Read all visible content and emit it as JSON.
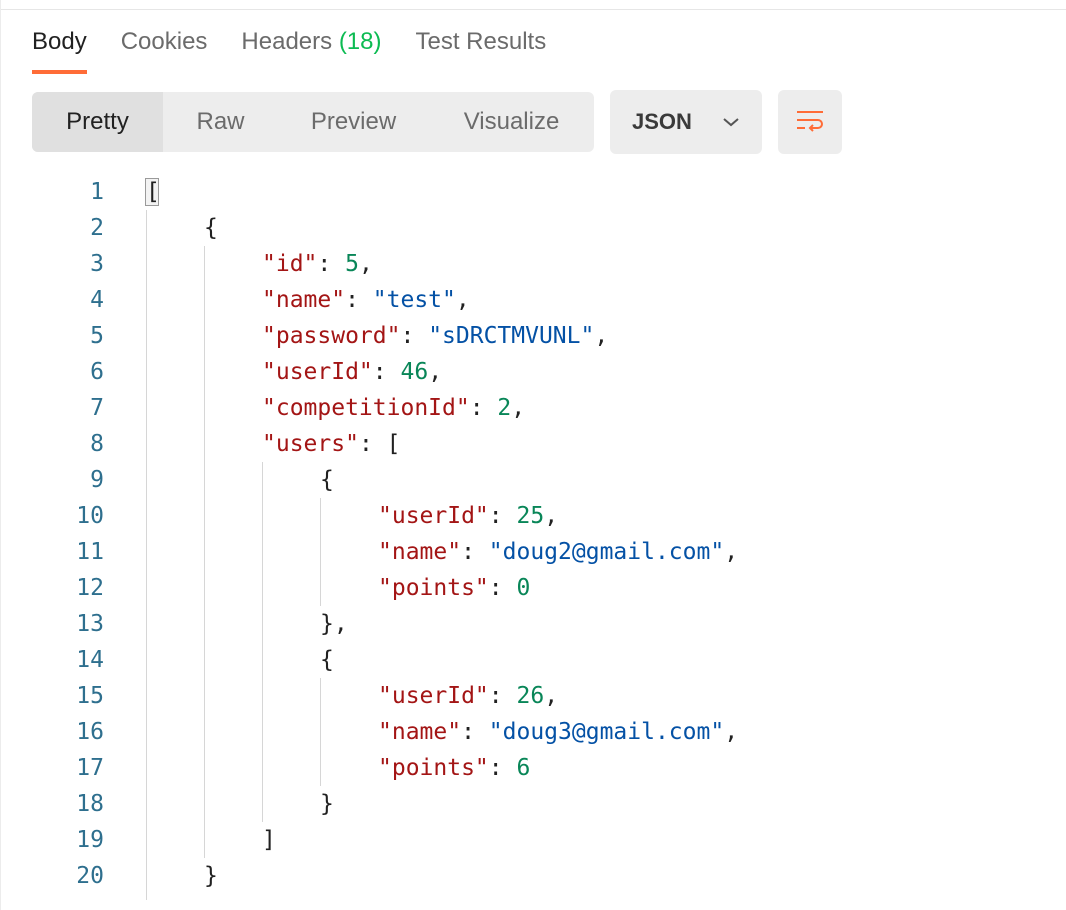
{
  "tabs": [
    {
      "label": "Body",
      "active": true
    },
    {
      "label": "Cookies",
      "active": false
    },
    {
      "label": "Headers",
      "count": "(18)",
      "active": false
    },
    {
      "label": "Test Results",
      "active": false
    }
  ],
  "view_modes": [
    {
      "label": "Pretty",
      "active": true
    },
    {
      "label": "Raw",
      "active": false
    },
    {
      "label": "Preview",
      "active": false
    },
    {
      "label": "Visualize",
      "active": false
    }
  ],
  "format_dropdown": {
    "value": "JSON",
    "icon": "chevron-down-icon"
  },
  "wrap_button": {
    "icon": "wrap-lines-icon"
  },
  "colors": {
    "accent": "#ff6c37",
    "count": "#0cbb52",
    "key": "#a31515",
    "string": "#0451a5",
    "number": "#098658",
    "line_number": "#2e6f8e"
  },
  "editor": {
    "lines": [
      {
        "n": "1",
        "tokens": [
          {
            "t": "p",
            "v": "["
          }
        ]
      },
      {
        "n": "2",
        "tokens": [
          {
            "t": "p",
            "v": "{"
          }
        ]
      },
      {
        "n": "3",
        "tokens": [
          {
            "t": "k",
            "v": "\"id\""
          },
          {
            "t": "p",
            "v": ": "
          },
          {
            "t": "n",
            "v": "5"
          },
          {
            "t": "p",
            "v": ","
          }
        ]
      },
      {
        "n": "4",
        "tokens": [
          {
            "t": "k",
            "v": "\"name\""
          },
          {
            "t": "p",
            "v": ": "
          },
          {
            "t": "s",
            "v": "\"test\""
          },
          {
            "t": "p",
            "v": ","
          }
        ]
      },
      {
        "n": "5",
        "tokens": [
          {
            "t": "k",
            "v": "\"password\""
          },
          {
            "t": "p",
            "v": ": "
          },
          {
            "t": "s",
            "v": "\"sDRCTMVUNL\""
          },
          {
            "t": "p",
            "v": ","
          }
        ]
      },
      {
        "n": "6",
        "tokens": [
          {
            "t": "k",
            "v": "\"userId\""
          },
          {
            "t": "p",
            "v": ": "
          },
          {
            "t": "n",
            "v": "46"
          },
          {
            "t": "p",
            "v": ","
          }
        ]
      },
      {
        "n": "7",
        "tokens": [
          {
            "t": "k",
            "v": "\"competitionId\""
          },
          {
            "t": "p",
            "v": ": "
          },
          {
            "t": "n",
            "v": "2"
          },
          {
            "t": "p",
            "v": ","
          }
        ]
      },
      {
        "n": "8",
        "tokens": [
          {
            "t": "k",
            "v": "\"users\""
          },
          {
            "t": "p",
            "v": ": ["
          }
        ]
      },
      {
        "n": "9",
        "tokens": [
          {
            "t": "p",
            "v": "{"
          }
        ]
      },
      {
        "n": "10",
        "tokens": [
          {
            "t": "k",
            "v": "\"userId\""
          },
          {
            "t": "p",
            "v": ": "
          },
          {
            "t": "n",
            "v": "25"
          },
          {
            "t": "p",
            "v": ","
          }
        ]
      },
      {
        "n": "11",
        "tokens": [
          {
            "t": "k",
            "v": "\"name\""
          },
          {
            "t": "p",
            "v": ": "
          },
          {
            "t": "s",
            "v": "\"doug2@gmail.com\""
          },
          {
            "t": "p",
            "v": ","
          }
        ]
      },
      {
        "n": "12",
        "tokens": [
          {
            "t": "k",
            "v": "\"points\""
          },
          {
            "t": "p",
            "v": ": "
          },
          {
            "t": "n",
            "v": "0"
          }
        ]
      },
      {
        "n": "13",
        "tokens": [
          {
            "t": "p",
            "v": "},"
          }
        ]
      },
      {
        "n": "14",
        "tokens": [
          {
            "t": "p",
            "v": "{"
          }
        ]
      },
      {
        "n": "15",
        "tokens": [
          {
            "t": "k",
            "v": "\"userId\""
          },
          {
            "t": "p",
            "v": ": "
          },
          {
            "t": "n",
            "v": "26"
          },
          {
            "t": "p",
            "v": ","
          }
        ]
      },
      {
        "n": "16",
        "tokens": [
          {
            "t": "k",
            "v": "\"name\""
          },
          {
            "t": "p",
            "v": ": "
          },
          {
            "t": "s",
            "v": "\"doug3@gmail.com\""
          },
          {
            "t": "p",
            "v": ","
          }
        ]
      },
      {
        "n": "17",
        "tokens": [
          {
            "t": "k",
            "v": "\"points\""
          },
          {
            "t": "p",
            "v": ": "
          },
          {
            "t": "n",
            "v": "6"
          }
        ]
      },
      {
        "n": "18",
        "tokens": [
          {
            "t": "p",
            "v": "}"
          }
        ]
      },
      {
        "n": "19",
        "tokens": [
          {
            "t": "p",
            "v": "]"
          }
        ]
      },
      {
        "n": "20",
        "tokens": [
          {
            "t": "p",
            "v": "}"
          }
        ]
      }
    ]
  }
}
